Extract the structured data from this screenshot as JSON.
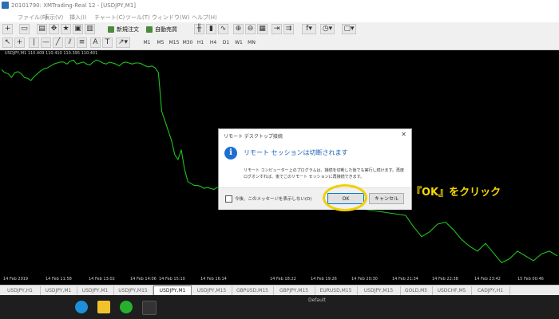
{
  "window": {
    "title": "20101790: XMTrading-Real 12 - [USDJPY,M1]"
  },
  "menu": [
    "ファイル(F)",
    "表示(V)",
    "挿入(I)",
    "チャート(C)",
    "ツール(T)",
    "ウィンドウ(W)",
    "ヘルプ(H)"
  ],
  "toolbar": {
    "new_order_label": "新規注文",
    "auto_trade_label": "自動売買",
    "timeframes": [
      "M1",
      "M5",
      "M15",
      "M30",
      "H1",
      "H4",
      "D1",
      "W1",
      "MN"
    ]
  },
  "chart": {
    "label": "USDJPY,M1  110.409 110.410 110.395 110.401",
    "x_ticks": [
      "14 Feb 2019",
      "14 Feb 11:58",
      "14 Feb 13:02",
      "14 Feb 14:06",
      "14 Feb 15:10",
      "14 Feb 16:14",
      "14 Feb 18:22",
      "14 Feb 19:26",
      "14 Feb 20:30",
      "14 Feb 21:34",
      "14 Feb 22:38",
      "14 Feb 23:42",
      "15 Feb 00:46"
    ],
    "line_color": "#22c21f",
    "chart_data": {
      "type": "line",
      "series": [
        {
          "values": [
            0.42,
            0.45,
            0.46,
            0.5,
            0.45,
            0.44,
            0.46,
            0.5,
            0.51,
            0.53,
            0.49,
            0.46,
            0.43,
            0.41,
            0.4,
            0.38,
            0.36,
            0.35,
            0.34,
            0.34,
            0.36,
            0.33,
            0.32,
            0.36,
            0.35,
            0.34,
            0.36,
            0.37,
            0.34,
            0.32,
            0.33,
            0.35,
            0.36,
            0.34,
            0.35,
            0.36,
            0.38,
            0.35,
            0.34,
            0.35,
            0.36,
            0.35,
            0.35,
            0.36,
            0.38,
            0.39,
            0.38,
            0.4,
            0.45,
            0.85,
            0.95,
            1.05,
            1.15,
            1.3,
            1.35,
            1.25,
            1.45,
            1.58,
            1.6,
            1.62,
            1.62,
            1.63,
            1.65,
            1.64,
            1.65,
            1.66,
            1.64,
            1.93,
            2.05,
            2.15,
            2.1,
            2.02,
            2.0,
            2.08,
            2.18,
            2.25,
            2.3,
            2.22,
            2.32,
            2.42,
            2.38,
            2.3,
            2.35,
            2.4,
            2.33,
            2.3,
            2.35
          ]
        }
      ]
    }
  },
  "dialog": {
    "title": "リモート デスクトップ接続",
    "heading": "リモート セッションは切断されます",
    "body": "リモート コンピューター上のプログラムは、接続を切断した後でも実行し続けます。再度ログオンすれば、後でこのリモート セッションに再接続できます。",
    "checkbox_label": "今後、このメッセージを表示しない(D)",
    "ok_label": "OK",
    "cancel_label": "キャンセル"
  },
  "annotation": "『OK』をクリック",
  "tabs": [
    "USDJPY,H1",
    "USDJPY,M1",
    "USDJPY,M1",
    "USDJPY,M15",
    "USDJPY,M1",
    "USDJPY,M15",
    "GBPUSD,M15",
    "GBPJPY,M15",
    "EURUSD,M15",
    "USDJPY,M15",
    "GOLD,M5",
    "USDCHF,M5",
    "CADJPY,H1"
  ],
  "active_tab_index": 4,
  "statusbar": {
    "text": "Default"
  }
}
